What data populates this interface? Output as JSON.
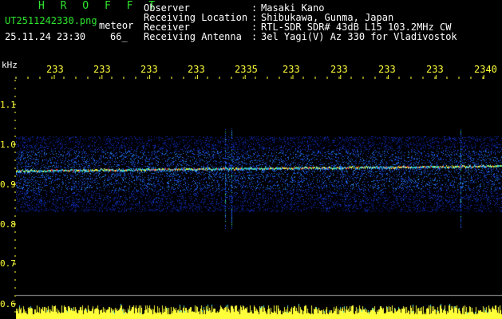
{
  "header": {
    "station": "H R O F F T",
    "filename": "UT2511242330.png",
    "type": "meteor",
    "datetime": "25.11.24 23:30",
    "count": "66_"
  },
  "info": [
    {
      "label": "Observer",
      "value": "Masaki Kano"
    },
    {
      "label": "Receiving Location",
      "value": "Shibukawa, Gunma, Japan"
    },
    {
      "label": "Receiver",
      "value": "RTL-SDR SDR# 43dB L15 103.2MHz CW"
    },
    {
      "label": "Receiving Antenna",
      "value": "3el Yagi(V) Az 330 for Vladivostok"
    }
  ],
  "axis": {
    "y_unit": "kHz",
    "x_ticks": [
      "233",
      "233",
      "233",
      "233",
      "2335",
      "233",
      "233",
      "233",
      "233",
      "2340"
    ],
    "y_ticks": [
      "1.1",
      "1.0",
      "0.9",
      "0.8",
      "0.7",
      "0.6"
    ]
  },
  "colors": {
    "background": "#000000",
    "title": "#2ee62e",
    "label": "#ffffff",
    "axis": "#ffff3a",
    "noise": "#1a3cc8"
  },
  "spectrogram": {
    "signal_khz": 0.935,
    "band_khz": [
      0.83,
      1.02
    ]
  }
}
